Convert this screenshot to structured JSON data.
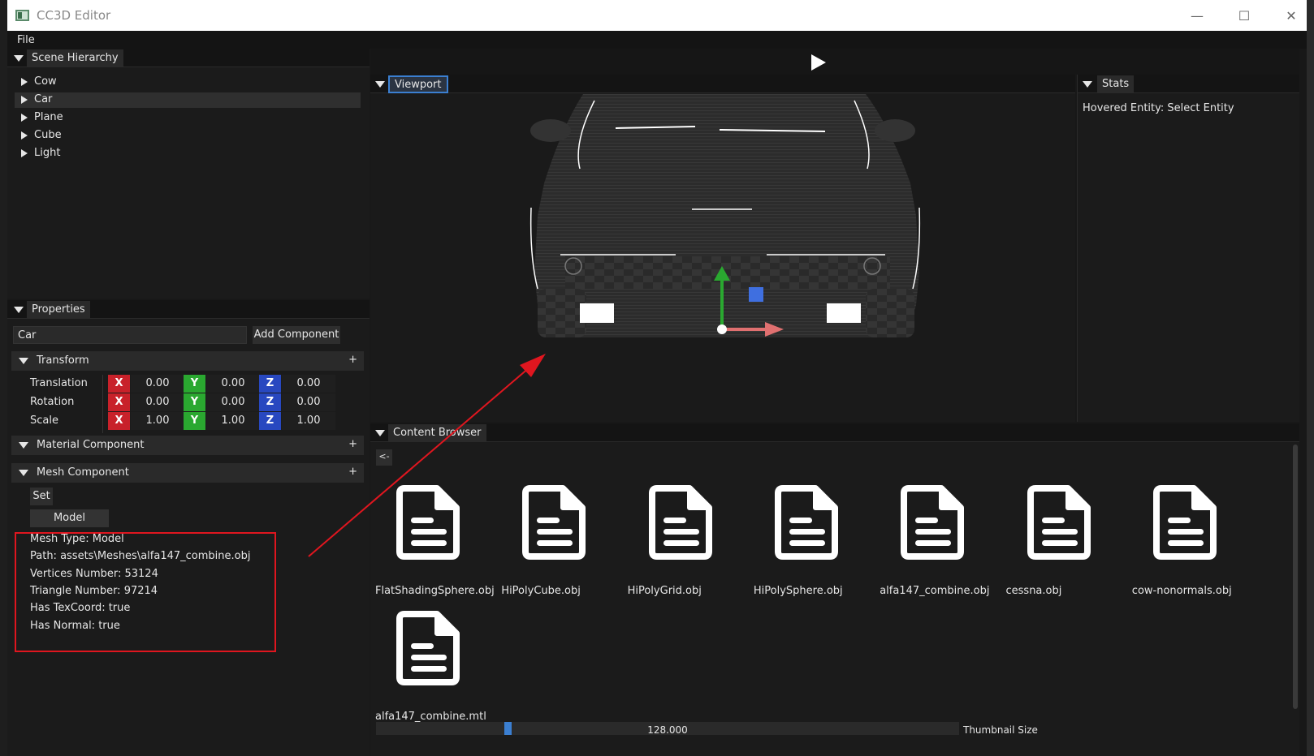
{
  "window": {
    "title": "CC3D Editor",
    "min_glyph": "—",
    "max_glyph": "☐",
    "close_glyph": "✕"
  },
  "menu": {
    "file": "File"
  },
  "hierarchy": {
    "title": "Scene Hierarchy",
    "items": [
      {
        "label": "Cow"
      },
      {
        "label": "Car",
        "selected": true
      },
      {
        "label": "Plane"
      },
      {
        "label": "Cube"
      },
      {
        "label": "Light"
      }
    ]
  },
  "properties": {
    "title": "Properties",
    "entity_name": "Car",
    "add_component": "Add Component",
    "transform": {
      "title": "Transform",
      "plus": "+",
      "rows": [
        {
          "label": "Translation",
          "x": "0.00",
          "y": "0.00",
          "z": "0.00"
        },
        {
          "label": "Rotation",
          "x": "0.00",
          "y": "0.00",
          "z": "0.00"
        },
        {
          "label": "Scale",
          "x": "1.00",
          "y": "1.00",
          "z": "1.00"
        }
      ],
      "axis_x": "X",
      "axis_y": "Y",
      "axis_z": "Z"
    },
    "material": {
      "title": "Material Component",
      "plus": "+"
    },
    "mesh": {
      "title": "Mesh Component",
      "plus": "+",
      "set": "Set",
      "model": "Model",
      "info": [
        "Mesh Type: Model",
        "Path: assets\\Meshes\\alfa147_combine.obj",
        "Vertices Number: 53124",
        "Triangle Number: 97214",
        "Has TexCoord: true",
        "Has Normal: true"
      ]
    }
  },
  "viewport": {
    "title": "Viewport"
  },
  "stats": {
    "title": "Stats",
    "hovered": "Hovered Entity: Select Entity"
  },
  "content_browser": {
    "title": "Content Browser",
    "back": "<-",
    "files": [
      "FlatShadingSphere.obj",
      "HiPolyCube.obj",
      "HiPolyGrid.obj",
      "HiPolySphere.obj",
      "alfa147_combine.obj",
      "cessna.obj",
      "cow-nonormals.obj",
      "alfa147_combine.mtl"
    ],
    "thumbnail_value": "128.000",
    "thumbnail_fraction": 0.22,
    "thumbnail_label": "Thumbnail Size"
  },
  "colors": {
    "accent": "#3b7fd1",
    "axis_x": "#c8212a",
    "axis_y": "#2aa830",
    "axis_z": "#2848c0",
    "highlight": "#e0161f"
  },
  "icons": {
    "file": "document-icon",
    "play": "play-icon",
    "collapse": "triangle-down-icon",
    "expand": "triangle-right-icon"
  }
}
